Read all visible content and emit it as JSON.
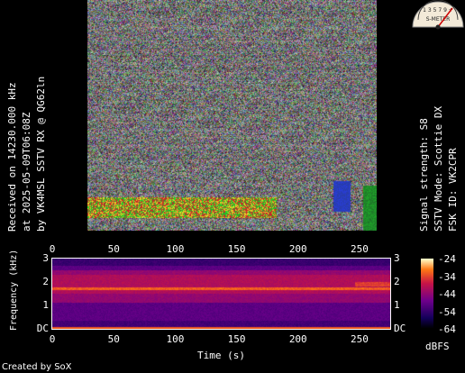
{
  "left_caption": {
    "line1": "Received on  14230.000 kHz",
    "line2": "at 2025-05-09T06:08Z",
    "line3": "by VK4MSL SSTV RX @ QG62ln"
  },
  "right_caption": {
    "line1": "Signal strength: S8",
    "line2": "SSTV Mode: Scottie DX",
    "line3": "FSK ID: VK2CPR"
  },
  "s_meter": {
    "scale_text": "1 3 5 7 9 +",
    "label": "S-METER",
    "reading": "S8"
  },
  "spectrogram": {
    "x_ticks": [
      "0",
      "50",
      "100",
      "150",
      "200",
      "250"
    ],
    "x_tick_values": [
      0,
      50,
      100,
      150,
      200,
      250
    ],
    "x_max": 275,
    "y_ticks_left": [
      "3",
      "2",
      "1",
      "DC"
    ],
    "y_ticks_right": [
      "3",
      "2",
      "1",
      "DC"
    ],
    "y_tick_values": [
      3,
      2,
      1,
      0
    ],
    "xlabel": "Time (s)",
    "ylabel": "Frequency (kHz)"
  },
  "colorbar": {
    "ticks": [
      "-24",
      "-34",
      "-44",
      "-54",
      "-64"
    ],
    "tick_values": [
      -24,
      -34,
      -44,
      -54,
      -64
    ],
    "unit": "dBFS"
  },
  "credit": "Created by SoX",
  "colors": {
    "background": "#000000",
    "spectro_low": "#1a0060",
    "spectro_mid": "#c0104a",
    "spectro_high": "#ffe070",
    "tone_line": "#ff1a1a"
  }
}
